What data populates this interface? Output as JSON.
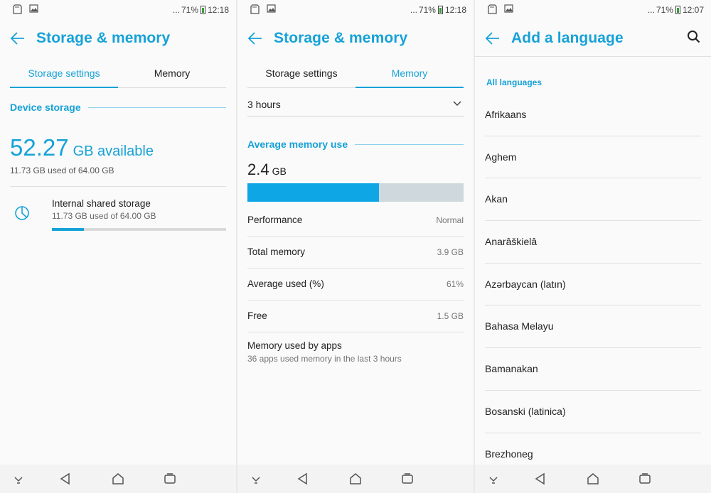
{
  "colors": {
    "accent": "#16a2d8",
    "bar_fill": "#0fa6e6",
    "bar_track": "#cfd8dc"
  },
  "panels": [
    {
      "status": {
        "left_icons": [
          "sd-card-icon",
          "image-icon"
        ],
        "dots": "...",
        "battery": "71%",
        "time": "12:18"
      },
      "appbar": {
        "title": "Storage & memory"
      },
      "tabs": [
        {
          "label": "Storage settings",
          "active": true
        },
        {
          "label": "Memory",
          "active": false
        }
      ],
      "section": "Device storage",
      "available": {
        "number": "52.27",
        "unit": "GB available"
      },
      "used_text": "11.73 GB used of 64.00 GB",
      "internal": {
        "title": "Internal shared storage",
        "subtitle": "11.73 GB used of 64.00 GB",
        "fraction_used": 0.1833
      }
    },
    {
      "status": {
        "left_icons": [
          "sd-card-icon",
          "image-icon"
        ],
        "dots": "...",
        "battery": "71%",
        "time": "12:18"
      },
      "appbar": {
        "title": "Storage & memory"
      },
      "tabs": [
        {
          "label": "Storage settings",
          "active": false
        },
        {
          "label": "Memory",
          "active": true
        }
      ],
      "period": {
        "selected": "3 hours"
      },
      "section": "Average memory use",
      "avg": {
        "number": "2.4",
        "unit": "GB",
        "fraction_used": 0.61
      },
      "stats": [
        {
          "label": "Performance",
          "value": "Normal"
        },
        {
          "label": "Total memory",
          "value": "3.9 GB"
        },
        {
          "label": "Average used (%)",
          "value": "61%"
        },
        {
          "label": "Free",
          "value": "1.5 GB"
        }
      ],
      "apps": {
        "title": "Memory used by apps",
        "subtitle": "36 apps used memory in the last 3 hours"
      }
    },
    {
      "status": {
        "left_icons": [
          "sd-card-icon",
          "image-icon"
        ],
        "dots": "...",
        "battery": "71%",
        "time": "12:07"
      },
      "appbar": {
        "title": "Add a language"
      },
      "section": "All languages",
      "languages": [
        "Afrikaans",
        "Aghem",
        "Akan",
        "Anarâškielâ",
        "Azərbaycan (latın)",
        "Bahasa Melayu",
        "Bamanakan",
        "Bosanski (latinica)",
        "Brezhoneg"
      ]
    }
  ],
  "navbar": {
    "buttons": [
      "hide-nav-icon",
      "back-nav-icon",
      "home-nav-icon",
      "recents-nav-icon"
    ]
  }
}
